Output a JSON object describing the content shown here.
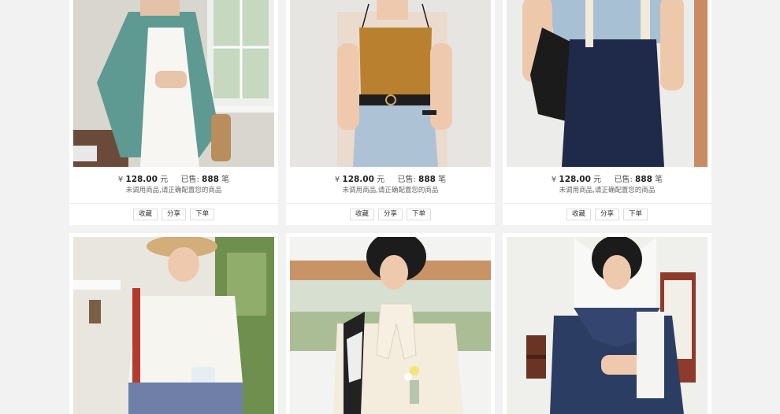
{
  "products": [
    {
      "currency": "¥",
      "price": "128.00",
      "price_unit": "元",
      "sold_label": "已售:",
      "sold_count": "888",
      "sold_unit": "笔",
      "note": "未调用商品,请正确配置您的商品",
      "actions": [
        "收藏",
        "分享",
        "下单"
      ]
    },
    {
      "currency": "¥",
      "price": "128.00",
      "price_unit": "元",
      "sold_label": "已售:",
      "sold_count": "888",
      "sold_unit": "笔",
      "note": "未调用商品,请正确配置您的商品",
      "actions": [
        "收藏",
        "分享",
        "下单"
      ]
    },
    {
      "currency": "¥",
      "price": "128.00",
      "price_unit": "元",
      "sold_label": "已售:",
      "sold_count": "888",
      "sold_unit": "笔",
      "note": "未调用商品,请正确配置您的商品",
      "actions": [
        "收藏",
        "分享",
        "下单"
      ]
    }
  ],
  "colors": {
    "page_bg": "#f2f2f2",
    "card_bg": "#ffffff",
    "text": "#333333"
  }
}
